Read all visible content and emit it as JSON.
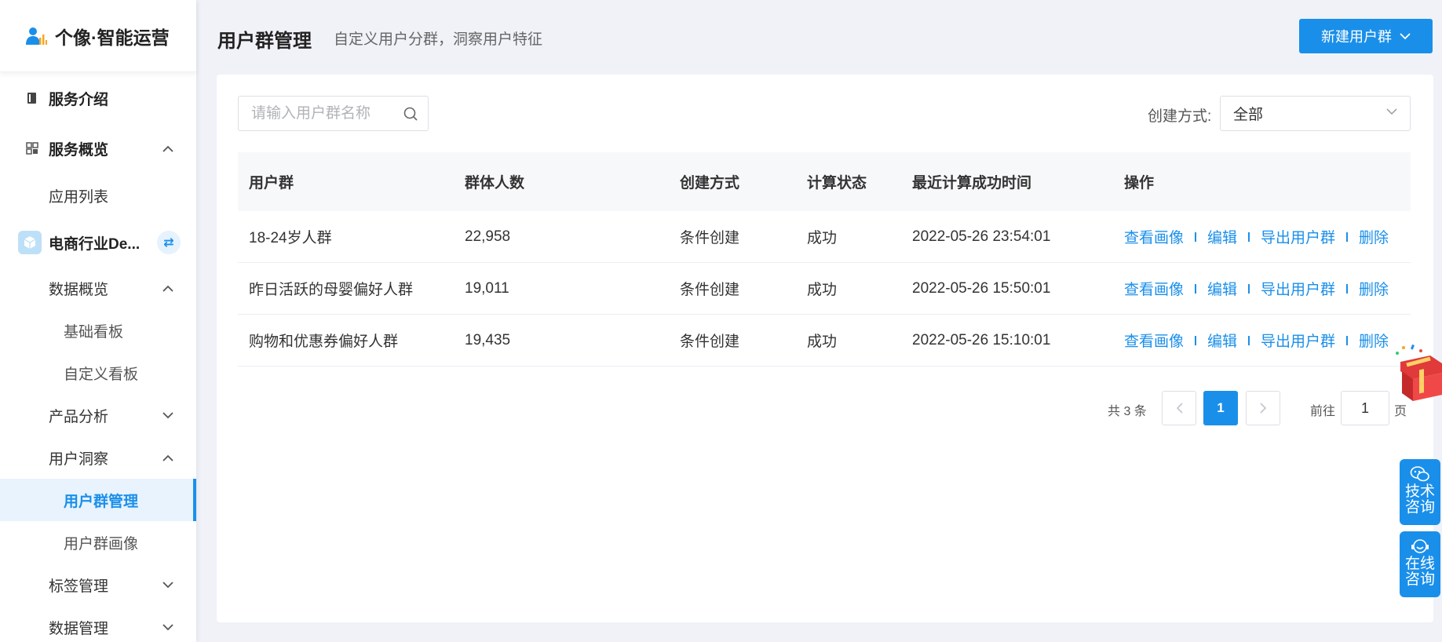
{
  "app": {
    "title": "个像·智能运营"
  },
  "sidebar": {
    "service_intro": "服务介绍",
    "service_overview": "服务概览",
    "app_list": "应用列表",
    "app_name": "电商行业De...",
    "data_overview": "数据概览",
    "basic_board": "基础看板",
    "custom_board": "自定义看板",
    "product_analysis": "产品分析",
    "user_insight": "用户洞察",
    "user_group_mgmt": "用户群管理",
    "user_group_portrait": "用户群画像",
    "tag_mgmt": "标签管理",
    "data_mgmt": "数据管理"
  },
  "header": {
    "title": "用户群管理",
    "subtitle": "自定义用户分群，洞察用户特征",
    "new_button": "新建用户群"
  },
  "filters": {
    "search_placeholder": "请输入用户群名称",
    "method_label": "创建方式:",
    "method_value": "全部"
  },
  "table": {
    "headers": [
      "用户群",
      "群体人数",
      "创建方式",
      "计算状态",
      "最近计算成功时间",
      "操作"
    ],
    "rows": [
      {
        "name": "18-24岁人群",
        "count": "22,958",
        "method": "条件创建",
        "status": "成功",
        "time": "2022-05-26 23:54:01"
      },
      {
        "name": "昨日活跃的母婴偏好人群",
        "count": "19,011",
        "method": "条件创建",
        "status": "成功",
        "time": "2022-05-26 15:50:01"
      },
      {
        "name": "购物和优惠券偏好人群",
        "count": "19,435",
        "method": "条件创建",
        "status": "成功",
        "time": "2022-05-26 15:10:01"
      }
    ],
    "actions": [
      "查看画像",
      "编辑",
      "导出用户群",
      "删除"
    ]
  },
  "pagination": {
    "total": "共 3 条",
    "current": "1",
    "goto_label": "前往",
    "goto_value": "1",
    "goto_unit": "页"
  },
  "float": {
    "tech_line1": "技术",
    "tech_line2": "咨询",
    "online_line1": "在线",
    "online_line2": "咨询"
  },
  "colors": {
    "accent": "#1a8fea",
    "background": "#f0f2f8"
  }
}
